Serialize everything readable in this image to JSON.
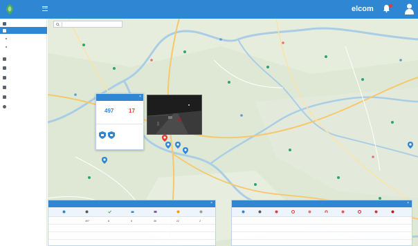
{
  "header": {
    "brand": "",
    "page_title": "",
    "account": "elcom",
    "user_label": ""
  },
  "sidebar": {
    "items": [
      {
        "label": ""
      },
      {
        "label": ""
      },
      {
        "label": ""
      },
      {
        "label": ""
      },
      {
        "label": ""
      },
      {
        "label": ""
      },
      {
        "label": ""
      },
      {
        "label": ""
      }
    ],
    "sub_items": [
      {
        "label": ""
      },
      {
        "label": ""
      }
    ]
  },
  "map": {
    "search_placeholder": "",
    "location_label": "",
    "place_label_2": ""
  },
  "popup": {
    "title": "",
    "stat1_label": "",
    "stat1_value": "497",
    "stat2_label": "",
    "stat2_value": "17",
    "note": "",
    "section_label": "",
    "link": ""
  },
  "panels": {
    "left_title": "",
    "right_title": "",
    "left_rows": [
      {
        "name": "",
        "cells": [
          "497",
          "8",
          "5",
          "36",
          "22",
          "2",
          "9"
        ]
      },
      {
        "name": "",
        "cells": [
          "",
          "",
          "",
          "",
          "",
          "",
          ""
        ]
      },
      {
        "name": "",
        "cells": [
          "",
          "",
          "",
          "",
          "",
          "",
          ""
        ]
      }
    ],
    "right_rows": [
      {
        "name": "",
        "cells": [
          "",
          "",
          "",
          "",
          "",
          "",
          "",
          "",
          "",
          ""
        ]
      },
      {
        "name": "",
        "cells": [
          "",
          "",
          "",
          "",
          "",
          "",
          "",
          "",
          "",
          ""
        ]
      },
      {
        "name": "",
        "cells": [
          "",
          "",
          "",
          "",
          "",
          "",
          "",
          "",
          "",
          ""
        ]
      }
    ]
  },
  "colors": {
    "primary": "#2f86d3",
    "stat_blue": "#2f86d3",
    "stat_red": "#e53935",
    "map_land": "#dfe8d4",
    "river": "#a9cde6",
    "road_major": "#f6c86a"
  }
}
